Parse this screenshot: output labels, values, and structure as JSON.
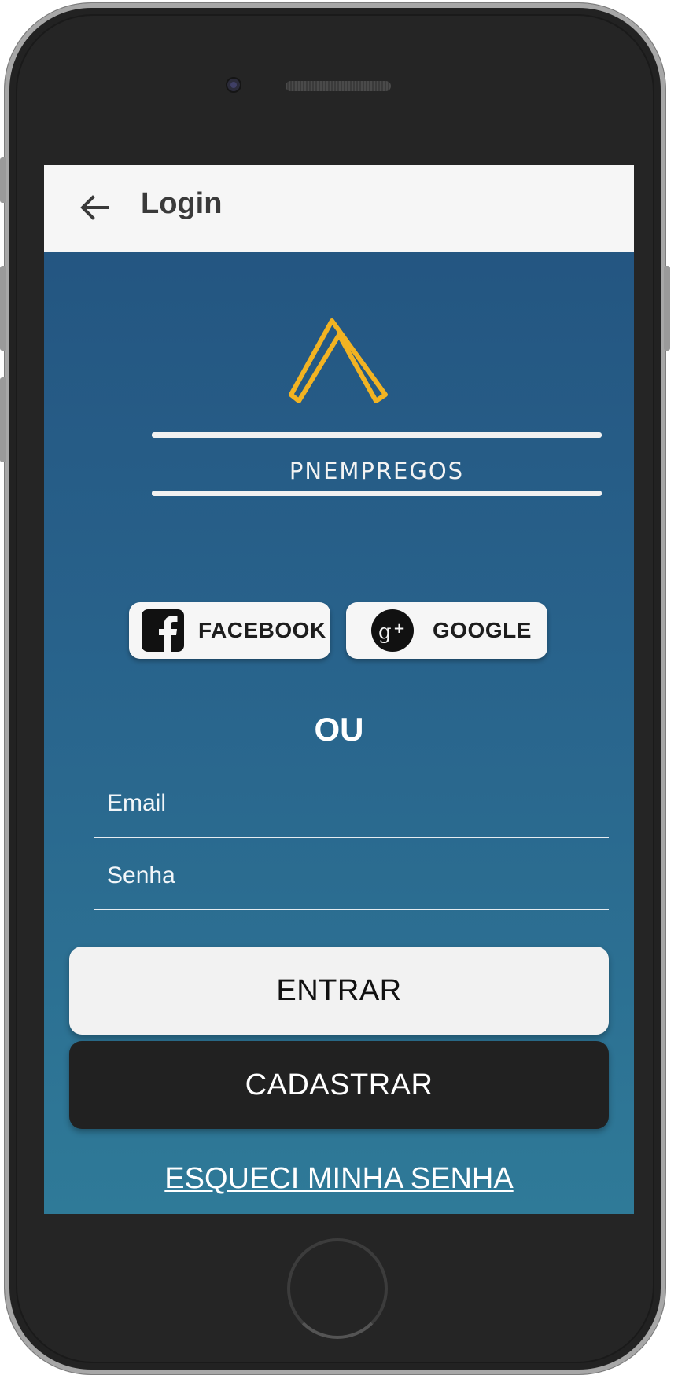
{
  "app_bar": {
    "title": "Login",
    "back_icon": "arrow-left-icon"
  },
  "logo": {
    "brand": "PNEMPREGOS",
    "mark_color": "#f2b322"
  },
  "social": {
    "facebook_label": "FACEBOOK",
    "facebook_icon": "facebook-icon",
    "google_label": "GOOGLE",
    "google_icon": "google-plus-icon"
  },
  "separator": "OU",
  "form": {
    "email_placeholder": "Email",
    "password_placeholder": "Senha"
  },
  "buttons": {
    "login_label": "ENTRAR",
    "register_label": "CADASTRAR"
  },
  "forgot_password": "ESQUECI MINHA SENHA",
  "colors": {
    "background_top": "#23537f",
    "background_bottom": "#2f7a98",
    "app_bar": "#f6f6f6",
    "primary_button": "#f2f2f2",
    "secondary_button": "#212121"
  }
}
